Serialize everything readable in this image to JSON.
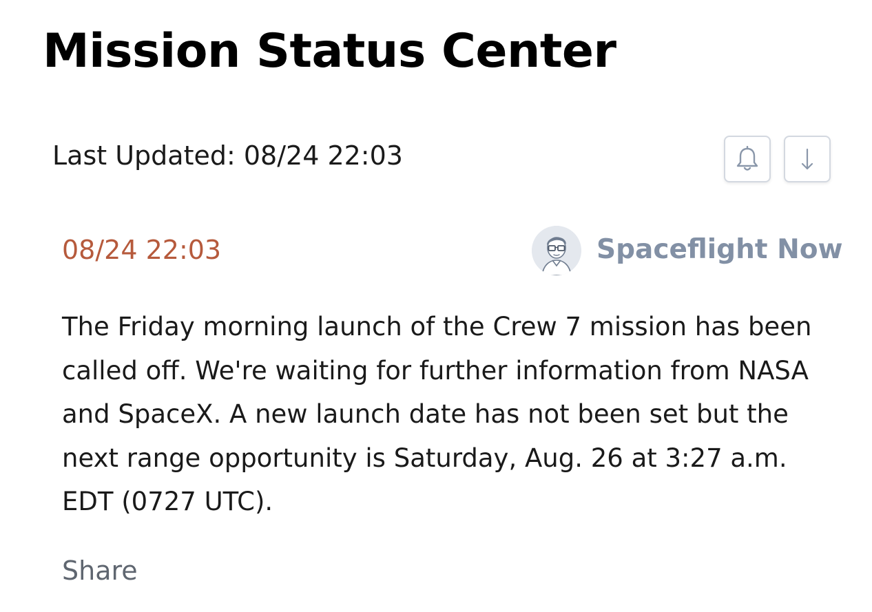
{
  "page": {
    "title": "Mission Status Center",
    "last_updated": "Last Updated: 08/24 22:03"
  },
  "toolbar": {
    "notify_icon": "bell-icon",
    "download_icon": "down-arrow-icon"
  },
  "entry": {
    "time": "08/24 22:03",
    "author": "Spaceflight Now",
    "avatar_icon": "person-avatar-icon",
    "body": "The Friday morning launch of the Crew 7 mission has been called off. We're waiting for further information from NASA and SpaceX. A new launch date has not been set but the next range opportunity is Saturday, Aug. 26 at 3:27 a.m. EDT (0727 UTC).",
    "share_label": "Share"
  },
  "colors": {
    "timestamp": "#b65a3c",
    "author": "#8290a5",
    "share": "#5f6670",
    "icon": "#8a97aa"
  }
}
